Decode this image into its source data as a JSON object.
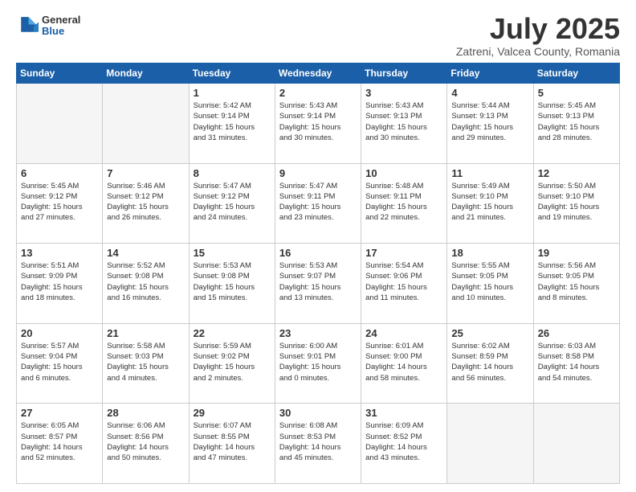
{
  "header": {
    "logo_general": "General",
    "logo_blue": "Blue",
    "month_year": "July 2025",
    "location": "Zatreni, Valcea County, Romania"
  },
  "weekdays": [
    "Sunday",
    "Monday",
    "Tuesday",
    "Wednesday",
    "Thursday",
    "Friday",
    "Saturday"
  ],
  "weeks": [
    [
      {
        "day": "",
        "info": ""
      },
      {
        "day": "",
        "info": ""
      },
      {
        "day": "1",
        "info": "Sunrise: 5:42 AM\nSunset: 9:14 PM\nDaylight: 15 hours\nand 31 minutes."
      },
      {
        "day": "2",
        "info": "Sunrise: 5:43 AM\nSunset: 9:14 PM\nDaylight: 15 hours\nand 30 minutes."
      },
      {
        "day": "3",
        "info": "Sunrise: 5:43 AM\nSunset: 9:13 PM\nDaylight: 15 hours\nand 30 minutes."
      },
      {
        "day": "4",
        "info": "Sunrise: 5:44 AM\nSunset: 9:13 PM\nDaylight: 15 hours\nand 29 minutes."
      },
      {
        "day": "5",
        "info": "Sunrise: 5:45 AM\nSunset: 9:13 PM\nDaylight: 15 hours\nand 28 minutes."
      }
    ],
    [
      {
        "day": "6",
        "info": "Sunrise: 5:45 AM\nSunset: 9:12 PM\nDaylight: 15 hours\nand 27 minutes."
      },
      {
        "day": "7",
        "info": "Sunrise: 5:46 AM\nSunset: 9:12 PM\nDaylight: 15 hours\nand 26 minutes."
      },
      {
        "day": "8",
        "info": "Sunrise: 5:47 AM\nSunset: 9:12 PM\nDaylight: 15 hours\nand 24 minutes."
      },
      {
        "day": "9",
        "info": "Sunrise: 5:47 AM\nSunset: 9:11 PM\nDaylight: 15 hours\nand 23 minutes."
      },
      {
        "day": "10",
        "info": "Sunrise: 5:48 AM\nSunset: 9:11 PM\nDaylight: 15 hours\nand 22 minutes."
      },
      {
        "day": "11",
        "info": "Sunrise: 5:49 AM\nSunset: 9:10 PM\nDaylight: 15 hours\nand 21 minutes."
      },
      {
        "day": "12",
        "info": "Sunrise: 5:50 AM\nSunset: 9:10 PM\nDaylight: 15 hours\nand 19 minutes."
      }
    ],
    [
      {
        "day": "13",
        "info": "Sunrise: 5:51 AM\nSunset: 9:09 PM\nDaylight: 15 hours\nand 18 minutes."
      },
      {
        "day": "14",
        "info": "Sunrise: 5:52 AM\nSunset: 9:08 PM\nDaylight: 15 hours\nand 16 minutes."
      },
      {
        "day": "15",
        "info": "Sunrise: 5:53 AM\nSunset: 9:08 PM\nDaylight: 15 hours\nand 15 minutes."
      },
      {
        "day": "16",
        "info": "Sunrise: 5:53 AM\nSunset: 9:07 PM\nDaylight: 15 hours\nand 13 minutes."
      },
      {
        "day": "17",
        "info": "Sunrise: 5:54 AM\nSunset: 9:06 PM\nDaylight: 15 hours\nand 11 minutes."
      },
      {
        "day": "18",
        "info": "Sunrise: 5:55 AM\nSunset: 9:05 PM\nDaylight: 15 hours\nand 10 minutes."
      },
      {
        "day": "19",
        "info": "Sunrise: 5:56 AM\nSunset: 9:05 PM\nDaylight: 15 hours\nand 8 minutes."
      }
    ],
    [
      {
        "day": "20",
        "info": "Sunrise: 5:57 AM\nSunset: 9:04 PM\nDaylight: 15 hours\nand 6 minutes."
      },
      {
        "day": "21",
        "info": "Sunrise: 5:58 AM\nSunset: 9:03 PM\nDaylight: 15 hours\nand 4 minutes."
      },
      {
        "day": "22",
        "info": "Sunrise: 5:59 AM\nSunset: 9:02 PM\nDaylight: 15 hours\nand 2 minutes."
      },
      {
        "day": "23",
        "info": "Sunrise: 6:00 AM\nSunset: 9:01 PM\nDaylight: 15 hours\nand 0 minutes."
      },
      {
        "day": "24",
        "info": "Sunrise: 6:01 AM\nSunset: 9:00 PM\nDaylight: 14 hours\nand 58 minutes."
      },
      {
        "day": "25",
        "info": "Sunrise: 6:02 AM\nSunset: 8:59 PM\nDaylight: 14 hours\nand 56 minutes."
      },
      {
        "day": "26",
        "info": "Sunrise: 6:03 AM\nSunset: 8:58 PM\nDaylight: 14 hours\nand 54 minutes."
      }
    ],
    [
      {
        "day": "27",
        "info": "Sunrise: 6:05 AM\nSunset: 8:57 PM\nDaylight: 14 hours\nand 52 minutes."
      },
      {
        "day": "28",
        "info": "Sunrise: 6:06 AM\nSunset: 8:56 PM\nDaylight: 14 hours\nand 50 minutes."
      },
      {
        "day": "29",
        "info": "Sunrise: 6:07 AM\nSunset: 8:55 PM\nDaylight: 14 hours\nand 47 minutes."
      },
      {
        "day": "30",
        "info": "Sunrise: 6:08 AM\nSunset: 8:53 PM\nDaylight: 14 hours\nand 45 minutes."
      },
      {
        "day": "31",
        "info": "Sunrise: 6:09 AM\nSunset: 8:52 PM\nDaylight: 14 hours\nand 43 minutes."
      },
      {
        "day": "",
        "info": ""
      },
      {
        "day": "",
        "info": ""
      }
    ]
  ]
}
